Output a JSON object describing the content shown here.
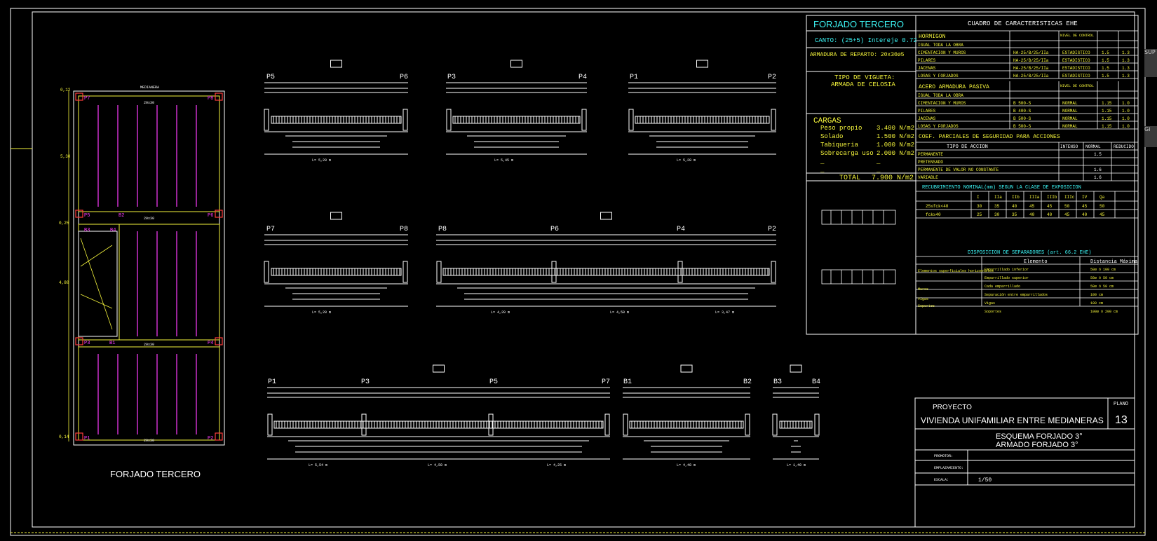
{
  "colors": {
    "background": "#000000",
    "line": "#ffffff",
    "cyan": "#3cf5f5",
    "yellow": "#f5f53c",
    "magenta": "#ff3cff",
    "red": "#ff3c3c"
  },
  "plan": {
    "title": "FORJADO TERCERO",
    "pillars": [
      "P7",
      "P8",
      "P5",
      "P6",
      "B3",
      "B4",
      "P3",
      "P4",
      "P1",
      "P2",
      "B2",
      "B1"
    ],
    "top_label": "MEDIANERA",
    "mid_label": "20x30",
    "dims_left": [
      "0,12",
      "5,30",
      "0,25",
      "4,80",
      "0,14"
    ]
  },
  "beams": {
    "row1": [
      {
        "left": "P5",
        "right": "P6",
        "length": "L= 5,28 m"
      },
      {
        "left": "P3",
        "right": "P4",
        "length": "L= 5,45 m"
      },
      {
        "left": "P1",
        "right": "P2",
        "length": "L= 5,28 m"
      }
    ],
    "row2": [
      {
        "left": "P7",
        "right": "P8",
        "length": "L= 5,28 m"
      },
      {
        "labels": [
          "P8",
          "P6",
          "P4",
          "P2"
        ],
        "lengths": [
          "L= 4,20 m",
          "L= 4,50 m",
          "L= 3,47 m"
        ]
      }
    ],
    "row3": [
      {
        "labels": [
          "P1",
          "P3",
          "P5",
          "P7"
        ],
        "lengths": [
          "L= 5,54 m",
          "L= 4,50 m",
          "L= 4,25 m"
        ]
      },
      {
        "left": "B1",
        "right": "B2",
        "length": "L= 4,48 m"
      },
      {
        "left": "B3",
        "right": "B4",
        "length": "L= 1,40 m"
      }
    ]
  },
  "info": {
    "title": "FORJADO TERCERO",
    "canto": "CANTO: (25+5) Intereje 0.72",
    "armadura": "ARMADURA DE REPARTO: 20x30ø5",
    "tipo_vigueta_1": "TIPO DE VIGUETA:",
    "tipo_vigueta_2": "ARMADA DE CELOSIA",
    "cargas_title": "CARGAS",
    "cargas": [
      {
        "name": "Peso propio",
        "value": "3.400 N/m2"
      },
      {
        "name": "Solado",
        "value": "1.500 N/m2"
      },
      {
        "name": "Tabiqueria",
        "value": "1.000 N/m2"
      },
      {
        "name": "Sobrecarga uso",
        "value": "2.000 N/m2"
      },
      {
        "name": "_",
        "value": "_"
      },
      {
        "name": "_",
        "value": "_"
      }
    ],
    "total_label": "TOTAL",
    "total_value": "7.900 N/m2"
  },
  "cuadro": {
    "title": "CUADRO DE CARACTERISTICAS   EHE",
    "hormigon_title": "HORMIGON",
    "nivel_control": "NIVEL DE CONTROL",
    "hormigon_rows": [
      {
        "name": "IGUAL TODA LA OBRA",
        "tipo": "",
        "nivel": "",
        "a": "",
        "b": ""
      },
      {
        "name": "CIMENTACION  Y  MUROS",
        "tipo": "HA-25/B/25/IIa",
        "nivel": "ESTADISTICO",
        "a": "1.5",
        "b": "1.3"
      },
      {
        "name": "PILARES",
        "tipo": "HA-25/B/25/IIa",
        "nivel": "ESTADISTICO",
        "a": "1.5",
        "b": "1.3"
      },
      {
        "name": "JACENAS",
        "tipo": "HA-25/B/25/IIa",
        "nivel": "ESTADISTICO",
        "a": "1.5",
        "b": "1.3"
      },
      {
        "name": "LOSAS Y FORJADOS",
        "tipo": "HA-25/B/25/IIa",
        "nivel": "ESTADISTICO",
        "a": "1.5",
        "b": "1.3"
      }
    ],
    "acero_title": "ACERO ARMADURA PASIVA",
    "acero_rows": [
      {
        "name": "IGUAL TODA LA OBRA",
        "tipo": "",
        "nivel": "",
        "a": "",
        "b": ""
      },
      {
        "name": "CIMENTACION  Y  MUROS",
        "tipo": "B 500-S",
        "nivel": "NORMAL",
        "a": "1.15",
        "b": "1.0"
      },
      {
        "name": "PILARES",
        "tipo": "B 400-S",
        "nivel": "NORMAL",
        "a": "1.15",
        "b": "1.0"
      },
      {
        "name": "JACENAS",
        "tipo": "B 500-S",
        "nivel": "NORMAL",
        "a": "1.15",
        "b": "1.0"
      },
      {
        "name": "LOSAS Y FORJADOS",
        "tipo": "B 500-S",
        "nivel": "NORMAL",
        "a": "1.15",
        "b": "1.0"
      }
    ],
    "coef_title": "COEF. PARCIALES DE SEGURIDAD PARA ACCIONES",
    "tipo_accion": "TIPO DE ACCION",
    "coef_cols": [
      "INTENSO",
      "NORMAL",
      "REDUCIDO"
    ],
    "coef_rows": [
      {
        "name": "PERMANENTE",
        "normal": "1.5"
      },
      {
        "name": "PRETENSADO",
        "normal": ""
      },
      {
        "name": "PERMANENTE DE VALOR NO CONSTANTE",
        "normal": "1.6"
      },
      {
        "name": "VARIABLE",
        "normal": "1.6"
      }
    ],
    "recub_title": "RECUBRIMIENTO NOMINAL(mm) SEGUN LA CLASE DE EXPOSICION",
    "recub_cols": [
      "I",
      "IIa",
      "IIb",
      "IIIa",
      "IIIb",
      "IIIc",
      "IV",
      "Qa"
    ],
    "recub_rows": [
      {
        "name": "25≤fck<40",
        "vals": [
          "30",
          "35",
          "40",
          "45",
          "45",
          "50",
          "45",
          "50"
        ]
      },
      {
        "name": "fck≥40",
        "vals": [
          "25",
          "30",
          "35",
          "40",
          "40",
          "45",
          "40",
          "45"
        ]
      }
    ],
    "separadores_title": "DISPOSICION DE SEPARADORES (art. 66.2 EHE)",
    "sep_head": [
      "Elemento",
      "Distancia Máxima"
    ],
    "sep_rows": [
      {
        "a": "Emparrillado inferior",
        "b": "50ø ó 100 cm"
      },
      {
        "a": "Emparrillado superior",
        "b": "50ø ó 50 cm"
      },
      {
        "a": "Cada emparrillado",
        "b": "50ø ó 50 cm"
      },
      {
        "a": "Separación entre emparrillados",
        "b": "100 cm"
      },
      {
        "a": "Vigas",
        "b": "100 cm"
      },
      {
        "a": "Soportes",
        "b": "100ø ó 200 cm"
      }
    ],
    "sep_left": [
      "Elementos superficiales horizontales",
      "Muros",
      "Vigas",
      "Soportes"
    ]
  },
  "title_block": {
    "proyecto_label": "PROYECTO",
    "proyecto": "VIVIENDA UNIFAMILIAR ENTRE MEDIANERAS",
    "plano_label": "PLANO",
    "plano": "13",
    "line1": "ESQUEMA FORJADO 3°",
    "line2": "ARMADO FORJADO 3°",
    "promotor": "PROMOTOR:",
    "emplazamiento": "EMPLAZAMIENTO:",
    "escala_label": "ESCALA:",
    "escala": "1/50"
  },
  "side_text": [
    "SUP",
    "Gi"
  ]
}
